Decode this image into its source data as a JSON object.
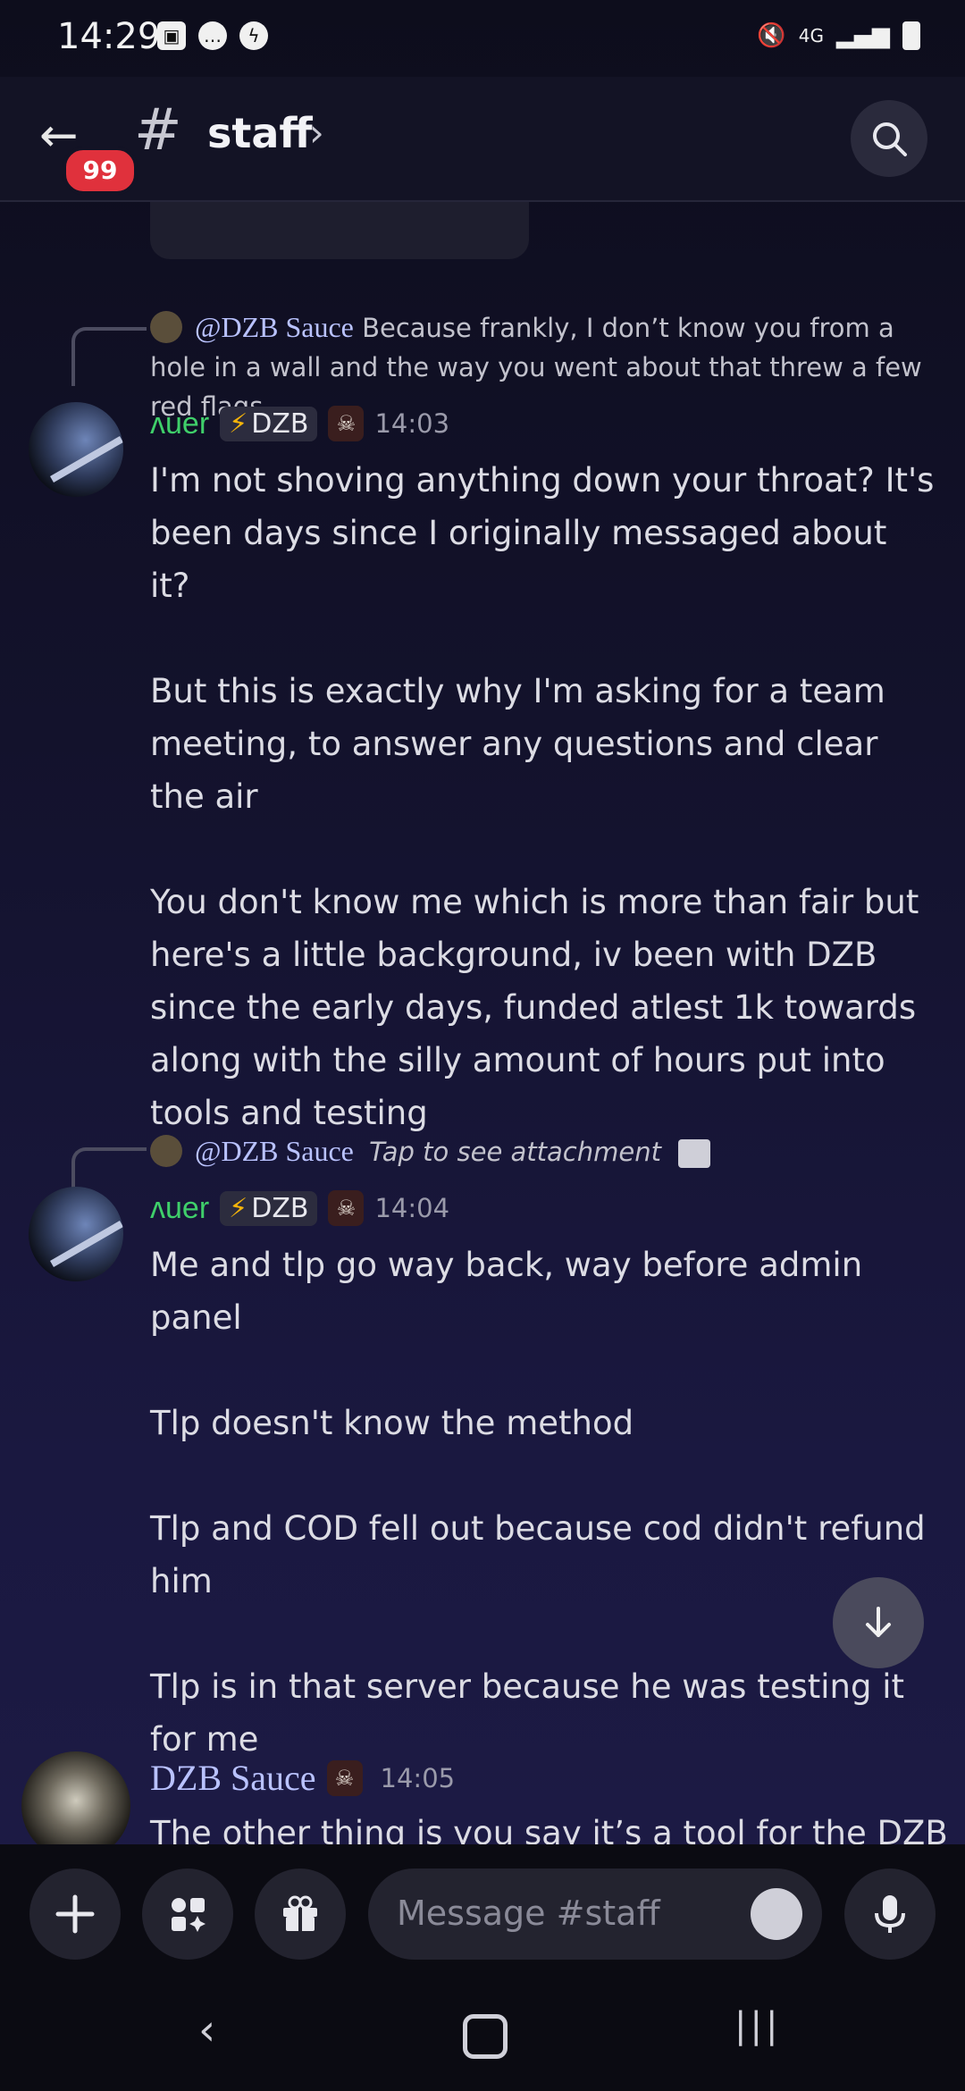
{
  "status_bar": {
    "time": "14:29",
    "network": "4G"
  },
  "header": {
    "back_badge": "99",
    "channel_name": "staff",
    "chevron": "›"
  },
  "messages": [
    {
      "reply_to": {
        "user": "@DZB Sauce",
        "text": "Because frankly, I don’t know you from a hole in a wall and the way you went about that threw a few red flags"
      },
      "author": "ᴧuer",
      "tag": "DZB",
      "time": "14:03",
      "text": "I'm not shoving anything down your throat? It's been days since I originally messaged about it?\n\nBut this is exactly why I'm asking for a team meeting, to answer any questions and clear the air\n\nYou don't know me which is more than fair but here's a little background, iv been with DZB since the early days, funded atlest 1k towards along with the silly amount of hours put into tools and testing"
    },
    {
      "reply_to": {
        "user": "@DZB Sauce",
        "text": "Tap to see attachment"
      },
      "author": "ᴧuer",
      "tag": "DZB",
      "time": "14:04",
      "text": "Me and tlp go way back, way before admin panel\n\nTlp doesn't know the method\n\nTlp and COD fell out because cod didn't refund him\n\nTlp is in that server because he was testing it for me"
    },
    {
      "author": "DZB Sauce",
      "time": "14:05",
      "text": "The other thing is you say it’s a tool for the DZB"
    }
  ],
  "composer": {
    "placeholder": "Message #staff"
  }
}
